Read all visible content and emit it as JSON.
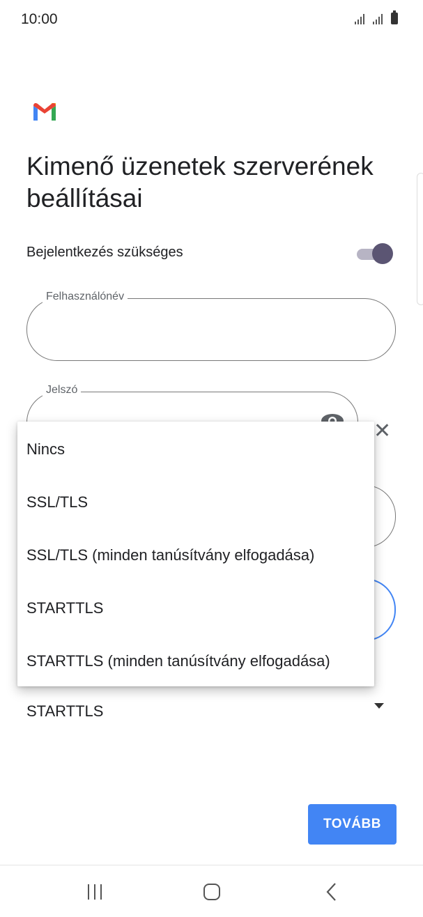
{
  "status_bar": {
    "time": "10:00"
  },
  "page": {
    "title": "Kimenő üzenetek szerverének beállításai"
  },
  "signin_toggle": {
    "label": "Bejelentkezés szükséges",
    "state": "on"
  },
  "fields": {
    "username_label": "Felhasználónév",
    "password_label": "Jelszó"
  },
  "security_select": {
    "selected": "STARTTLS",
    "options": [
      "Nincs",
      "SSL/TLS",
      "SSL/TLS (minden tanúsítvány elfogadása)",
      "STARTTLS",
      "STARTTLS (minden tanúsítvány elfogadása)"
    ]
  },
  "next_button": {
    "label": "TOVÁBB"
  },
  "colors": {
    "accent": "#4285f4",
    "toggle_thumb": "#5b5573",
    "toggle_track": "#b7b4c4"
  },
  "icons": [
    "gmail-logo",
    "eye-icon",
    "close-icon",
    "dropdown-arrow-icon",
    "recent-apps-icon",
    "home-icon",
    "back-icon"
  ]
}
